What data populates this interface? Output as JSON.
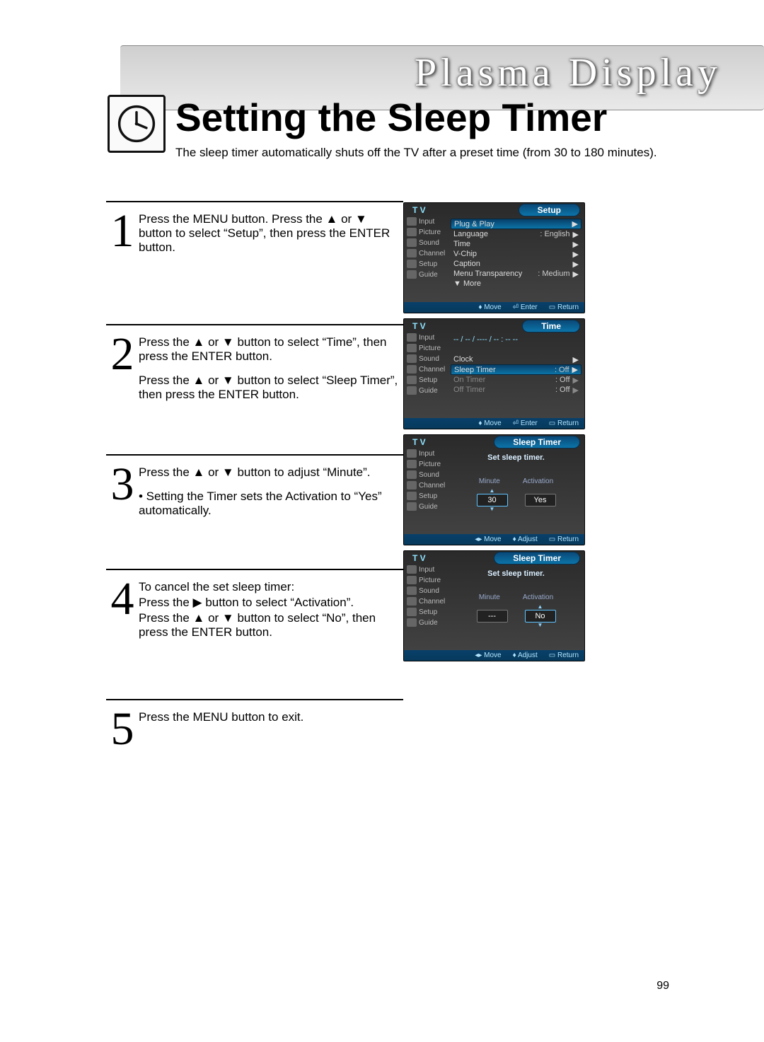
{
  "brand": "Plasma Display",
  "title": "Setting the Sleep Timer",
  "subtitle": "The sleep timer automatically shuts off the TV after a preset time (from 30 to 180 minutes).",
  "page_number": "99",
  "steps": {
    "s1": {
      "num": "1",
      "text": "Press the MENU button. Press the ▲ or ▼ button to select “Setup”, then press the ENTER button."
    },
    "s2": {
      "num": "2",
      "a": "Press the ▲ or ▼ button to select “Time”, then press the ENTER button.",
      "b": "Press the ▲ or ▼ button to select “Sleep Timer”, then press the ENTER button."
    },
    "s3": {
      "num": "3",
      "a": "Press the ▲ or ▼ button to adjust “Minute”.",
      "b": "•  Setting the Timer sets the Activation to “Yes” automatically."
    },
    "s4": {
      "num": "4",
      "a": "To cancel the set sleep timer:",
      "b": "Press the ▶ button to select “Activation”.",
      "c": "Press the ▲ or ▼ button to select “No”, then press the ENTER button."
    },
    "s5": {
      "num": "5",
      "a": "Press the MENU button to exit."
    }
  },
  "sidebar_labels": {
    "input": "Input",
    "picture": "Picture",
    "sound": "Sound",
    "channel": "Channel",
    "setup": "Setup",
    "guide": "Guide"
  },
  "osd1": {
    "header": "Setup",
    "items": [
      {
        "label": "Plug & Play",
        "value": "",
        "sel": true,
        "arrow": "▶"
      },
      {
        "label": "Language",
        "value": ": English",
        "arrow": "▶"
      },
      {
        "label": "Time",
        "value": "",
        "arrow": "▶"
      },
      {
        "label": "V-Chip",
        "value": "",
        "arrow": "▶"
      },
      {
        "label": "Caption",
        "value": "",
        "arrow": "▶"
      },
      {
        "label": "Menu Transparency",
        "value": ": Medium",
        "arrow": "▶"
      },
      {
        "label": "▼ More",
        "value": "",
        "arrow": ""
      }
    ],
    "foot": {
      "move": "Move",
      "enter": "Enter",
      "return": "Return"
    }
  },
  "osd2": {
    "header": "Time",
    "clock_text": "-- / -- / ---- / -- : -- --",
    "items": [
      {
        "label": "Clock",
        "value": "",
        "arrow": "▶"
      },
      {
        "label": "Sleep Timer",
        "value": ": Off",
        "sel": true,
        "arrow": "▶"
      },
      {
        "label": "On Timer",
        "value": ": Off",
        "dim": true,
        "arrow": "▶"
      },
      {
        "label": "Off Timer",
        "value": ": Off",
        "dim": true,
        "arrow": "▶"
      }
    ],
    "foot": {
      "move": "Move",
      "enter": "Enter",
      "return": "Return"
    }
  },
  "osd3": {
    "header": "Sleep Timer",
    "hint": "Set sleep timer.",
    "cols": {
      "minute": "Minute",
      "activation": "Activation"
    },
    "minute": "30",
    "activation": "Yes",
    "active_col": "minute",
    "foot": {
      "move": "Move",
      "adjust": "Adjust",
      "return": "Return"
    }
  },
  "osd4": {
    "header": "Sleep Timer",
    "hint": "Set sleep timer.",
    "cols": {
      "minute": "Minute",
      "activation": "Activation"
    },
    "minute": "---",
    "activation": "No",
    "active_col": "activation",
    "foot": {
      "move": "Move",
      "adjust": "Adjust",
      "return": "Return"
    }
  }
}
